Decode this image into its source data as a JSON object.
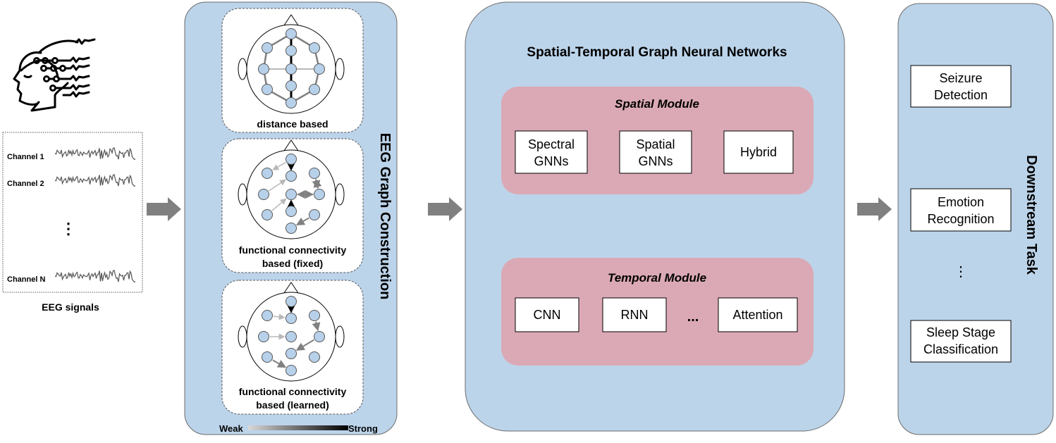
{
  "colors": {
    "panel": "#bcd4ea",
    "module": "#dba9b5",
    "node": "#b8d1ea",
    "arrow": "#808080"
  },
  "input": {
    "icon": "head-eeg-icon",
    "channels": [
      "Channel 1",
      "Channel 2",
      "Channel N"
    ],
    "ellipsis": "⋮",
    "caption": "EEG signals"
  },
  "graph_construction": {
    "title": "EEG Graph Construction",
    "graphs": [
      {
        "caption": [
          "distance based"
        ],
        "edges": [
          [
            0,
            2,
            "strong",
            false
          ],
          [
            2,
            5,
            "strong",
            false
          ],
          [
            5,
            8,
            "strong",
            false
          ],
          [
            8,
            10,
            "strong",
            false
          ],
          [
            0,
            1,
            "medium",
            false
          ],
          [
            0,
            3,
            "medium",
            false
          ],
          [
            1,
            4,
            "medium",
            false
          ],
          [
            3,
            6,
            "medium",
            false
          ],
          [
            4,
            7,
            "medium",
            false
          ],
          [
            6,
            9,
            "medium",
            false
          ],
          [
            7,
            10,
            "medium",
            false
          ],
          [
            9,
            10,
            "medium",
            false
          ],
          [
            4,
            5,
            "weak",
            false
          ],
          [
            5,
            6,
            "weak",
            false
          ]
        ]
      },
      {
        "caption": [
          "functional connectivity",
          "based (fixed)"
        ],
        "edges": [
          [
            0,
            1,
            "weak",
            true
          ],
          [
            0,
            2,
            "strong",
            true
          ],
          [
            4,
            2,
            "weak",
            true
          ],
          [
            7,
            5,
            "weak",
            true
          ],
          [
            8,
            5,
            "strong",
            true
          ],
          [
            5,
            6,
            "medium",
            true
          ],
          [
            6,
            5,
            "medium",
            true
          ],
          [
            3,
            6,
            "medium",
            true
          ],
          [
            6,
            3,
            "medium",
            true
          ],
          [
            9,
            10,
            "medium",
            true
          ]
        ]
      },
      {
        "caption": [
          "functional connectivity",
          "based (learned)"
        ],
        "edges": [
          [
            0,
            2,
            "strong",
            true
          ],
          [
            1,
            2,
            "weak",
            true
          ],
          [
            4,
            5,
            "weak",
            true
          ],
          [
            3,
            6,
            "medium",
            true
          ],
          [
            6,
            8,
            "medium",
            true
          ],
          [
            7,
            10,
            "medium",
            true
          ]
        ]
      }
    ],
    "legend": {
      "weak": "Weak",
      "strong": "Strong"
    }
  },
  "stgnn": {
    "title": "Spatial-Temporal Graph Neural Networks",
    "spatial": {
      "title": "Spatial Module",
      "items": [
        [
          "Spectral",
          "GNNs"
        ],
        [
          "Spatial",
          "GNNs"
        ],
        [
          "Hybrid"
        ]
      ]
    },
    "temporal": {
      "title": "Temporal Module",
      "items": [
        "CNN",
        "RNN",
        "Attention"
      ],
      "ellipsis": "..."
    }
  },
  "downstream": {
    "title": "Downstream Task",
    "tasks": [
      [
        "Seizure",
        "Detection"
      ],
      [
        "Emotion",
        "Recognition"
      ],
      [
        "Sleep Stage",
        "Classification"
      ]
    ],
    "ellipsis": "⋮"
  }
}
